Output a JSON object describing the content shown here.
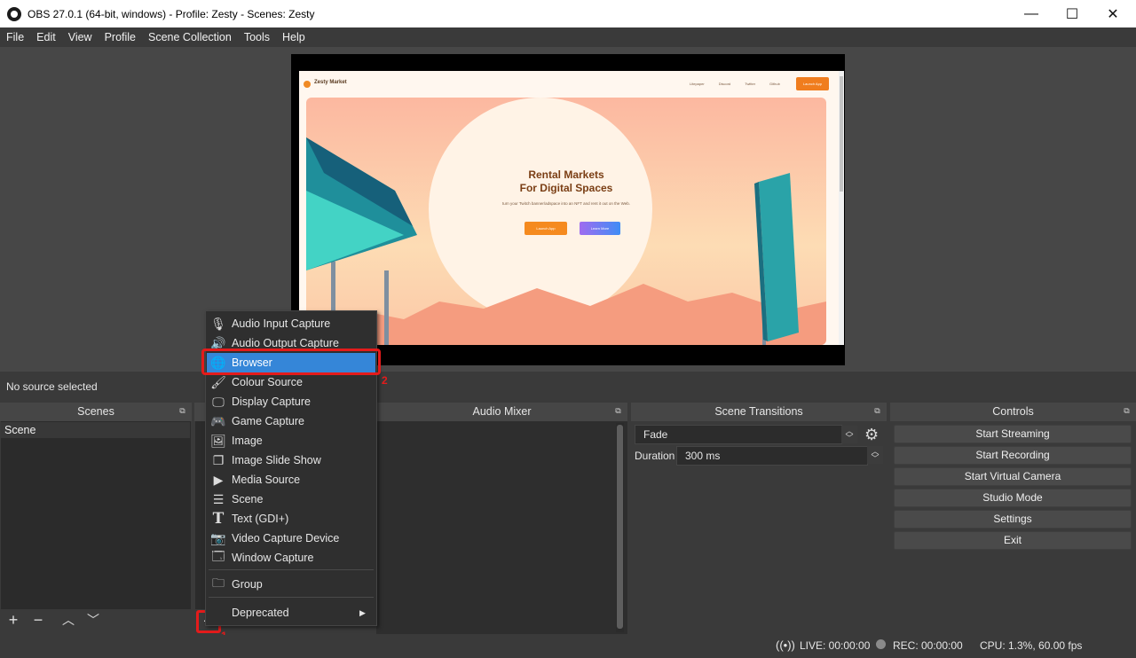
{
  "window": {
    "title": "OBS 27.0.1 (64-bit, windows) - Profile: Zesty - Scenes: Zesty",
    "min_glyph": "—",
    "max_glyph": "☐",
    "close_glyph": "✕"
  },
  "menu": [
    "File",
    "Edit",
    "View",
    "Profile",
    "Scene Collection",
    "Tools",
    "Help"
  ],
  "preview": {
    "site_logo": "Zesty Market",
    "site_links": [
      "Litepaper",
      "Discord",
      "Twitter",
      "Github"
    ],
    "site_cta": "Launch App",
    "hero_title_1": "Rental Markets",
    "hero_title_2": "For Digital Spaces",
    "hero_subtitle": "turn your Twitch banner/adspace into an NFT and rent it out on the Web.",
    "hero_btn_1": "Launch App",
    "hero_btn_2": "Learn More"
  },
  "source_status": "No source selected",
  "docks": {
    "scenes": {
      "title": "Scenes",
      "items": [
        "Scene"
      ]
    },
    "mixer": {
      "title": "Audio Mixer"
    },
    "transitions": {
      "title": "Scene Transitions",
      "selected": "Fade",
      "duration_label": "Duration",
      "duration_value": "300 ms"
    },
    "controls": {
      "title": "Controls",
      "buttons": [
        "Start Streaming",
        "Start Recording",
        "Start Virtual Camera",
        "Studio Mode",
        "Settings",
        "Exit"
      ]
    }
  },
  "context_menu": {
    "items": [
      {
        "label": "Audio Input Capture",
        "icon": "microphone-icon"
      },
      {
        "label": "Audio Output Capture",
        "icon": "speaker-icon"
      },
      {
        "label": "Browser",
        "icon": "globe-icon"
      },
      {
        "label": "Colour Source",
        "icon": "brush-icon"
      },
      {
        "label": "Display Capture",
        "icon": "monitor-icon"
      },
      {
        "label": "Game Capture",
        "icon": "gamepad-icon"
      },
      {
        "label": "Image",
        "icon": "image-icon"
      },
      {
        "label": "Image Slide Show",
        "icon": "slideshow-icon"
      },
      {
        "label": "Media Source",
        "icon": "play-icon"
      },
      {
        "label": "Scene",
        "icon": "list-icon"
      },
      {
        "label": "Text (GDI+)",
        "icon": "text-icon"
      },
      {
        "label": "Video Capture Device",
        "icon": "camera-icon"
      },
      {
        "label": "Window Capture",
        "icon": "window-icon"
      }
    ],
    "group": "Group",
    "deprecated": "Deprecated",
    "highlighted": "Browser"
  },
  "annotations": {
    "step1": "1",
    "step2": "2"
  },
  "status": {
    "live": "LIVE: 00:00:00",
    "rec": "REC: 00:00:00",
    "cpu": "CPU: 1.3%, 60.00 fps"
  },
  "colors": {
    "accent": "#3586d8",
    "annotation": "#e41b1b"
  }
}
